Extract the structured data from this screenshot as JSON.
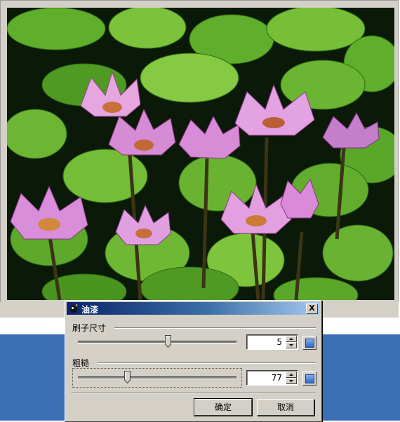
{
  "dialog": {
    "title": "油漆",
    "close_label": "X",
    "brush_size": {
      "label": "刷子尺寸",
      "value": "5"
    },
    "roughness": {
      "label": "粗糙",
      "value": "77"
    },
    "ok_label": "确定",
    "cancel_label": "取消"
  },
  "icons": {
    "title_icon": "paint-bomb-icon",
    "close": "close-icon",
    "spin_up": "arrow-up-icon",
    "spin_down": "arrow-down-icon",
    "reset": "reset-icon"
  },
  "colors": {
    "titlebar_start": "#0a246a",
    "titlebar_end": "#a6caf0",
    "window_face": "#d4d0c8",
    "desktop": "#3a6fb6"
  }
}
